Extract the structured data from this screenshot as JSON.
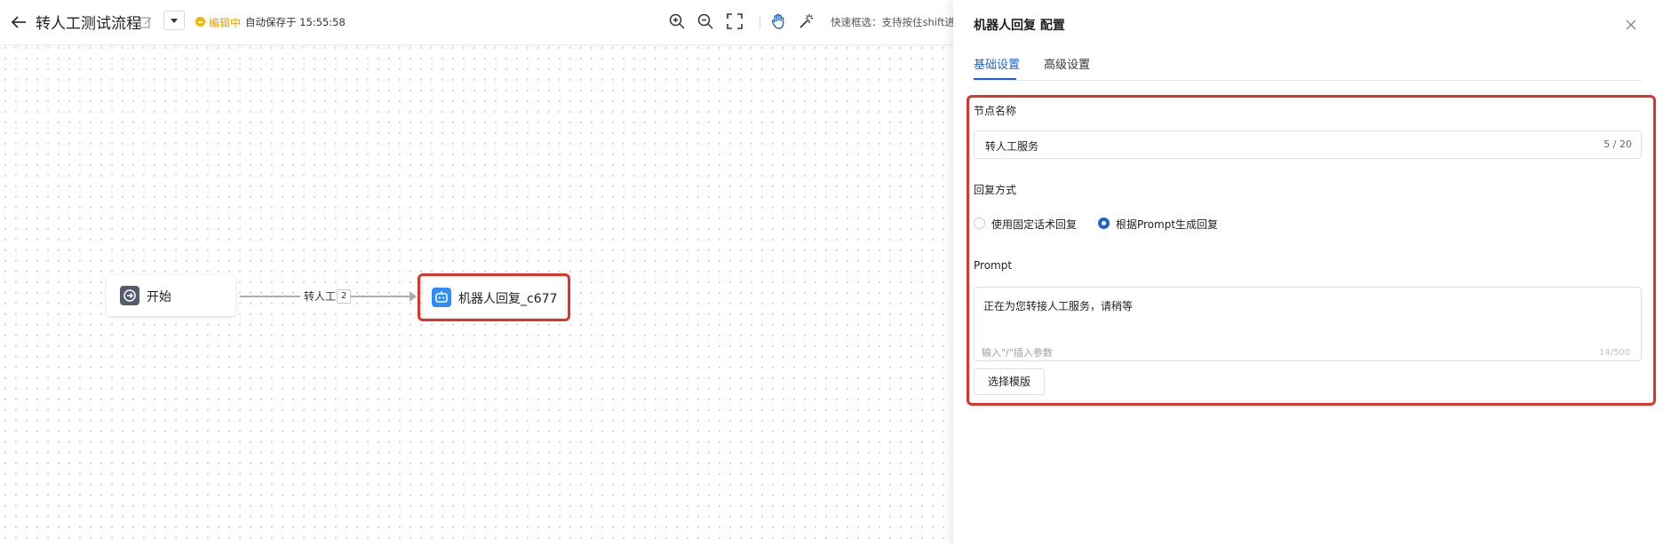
{
  "header": {
    "title": "转人工测试流程",
    "status": "编辑中",
    "autosave": "自动保存于 15:55:58",
    "quick_select_hint": "快速框选：支持按住shift进",
    "icons": [
      "back-arrow-icon",
      "edit-icon",
      "caret-down-icon",
      "zoom-in-icon",
      "zoom-out-icon",
      "fullscreen-icon",
      "hand-icon",
      "magic-wand-icon"
    ]
  },
  "canvas": {
    "nodes": [
      {
        "label": "开始",
        "icon": "start-icon"
      },
      {
        "label": "机器人回复_c677",
        "icon": "robot-icon"
      }
    ],
    "edge": {
      "label": "转人工",
      "badge": "2"
    }
  },
  "panel": {
    "title": "机器人回复 配置",
    "tabs": [
      {
        "label": "基础设置",
        "active": true
      },
      {
        "label": "高级设置",
        "active": false
      }
    ],
    "node_name": {
      "label": "节点名称",
      "value": "转人工服务",
      "count": "5 / 20"
    },
    "reply_mode": {
      "label": "回复方式",
      "options": [
        {
          "label": "使用固定话术回复",
          "selected": false
        },
        {
          "label": "根据Prompt生成回复",
          "selected": true
        }
      ]
    },
    "prompt": {
      "label": "Prompt",
      "value": "正在为您转接人工服务，请稍等",
      "placeholder": "输入\"/\"插入参数",
      "count": "14/500"
    },
    "template_button": "选择模版"
  },
  "colors": {
    "accent": "#1e63d6",
    "highlight": "#e0332b",
    "status": "#f5b400"
  }
}
